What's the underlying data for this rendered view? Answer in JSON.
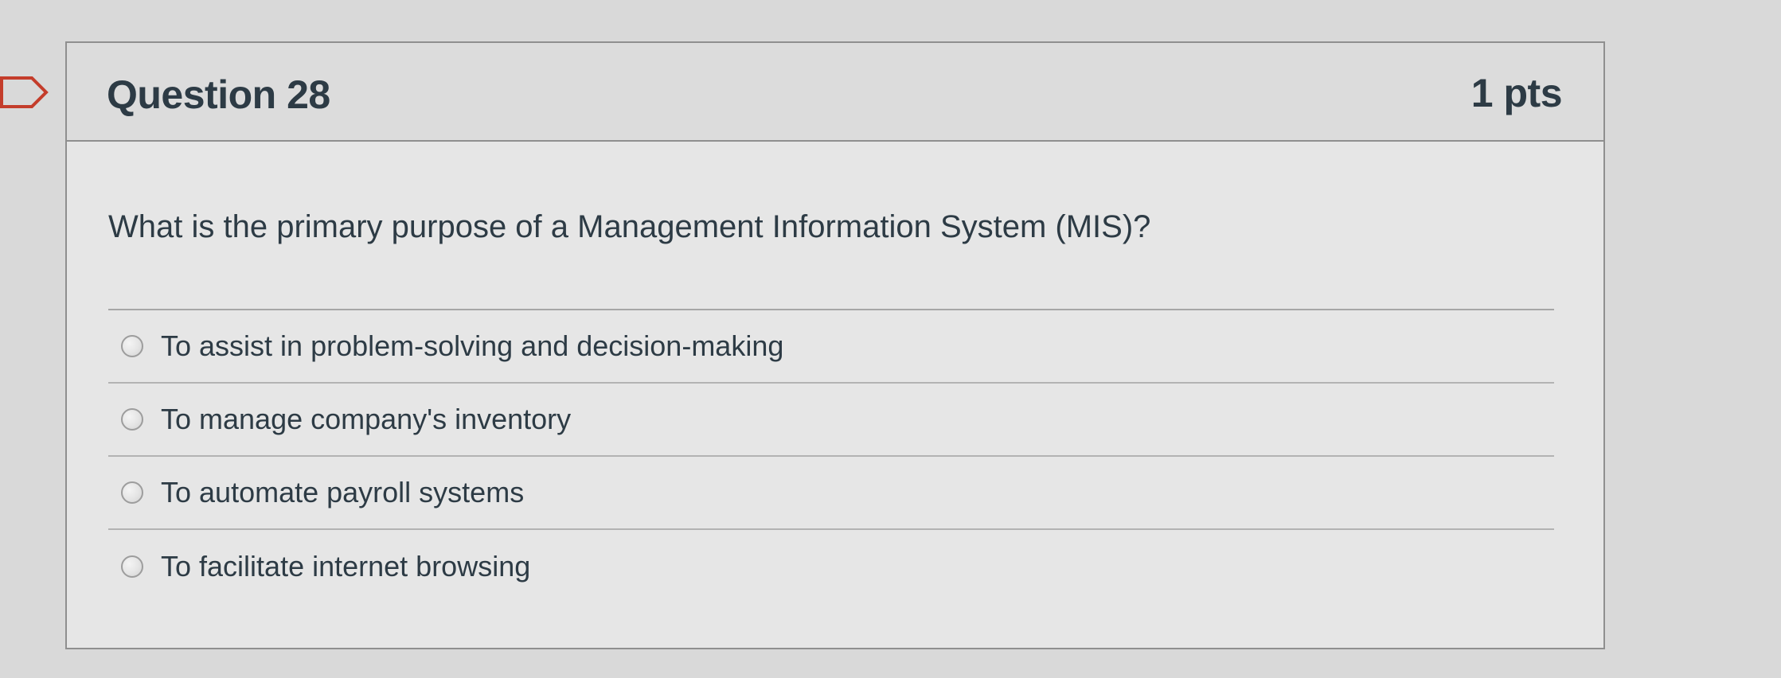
{
  "question": {
    "title": "Question 28",
    "points": "1 pts",
    "text": "What is the primary purpose of a Management Information System (MIS)?",
    "answers": [
      {
        "label": "To assist in problem-solving and decision-making"
      },
      {
        "label": "To manage company's inventory"
      },
      {
        "label": "To automate payroll systems"
      },
      {
        "label": "To facilitate internet browsing"
      }
    ],
    "selected_index": null
  },
  "icons": {
    "flag": "flag-question-icon",
    "radio": "radio-unselected-icon"
  },
  "colors": {
    "background": "#d9d9d9",
    "card_background": "#e6e6e6",
    "header_background": "#dcdcdc",
    "border": "#8f8f8f",
    "text": "#2d3b45"
  }
}
